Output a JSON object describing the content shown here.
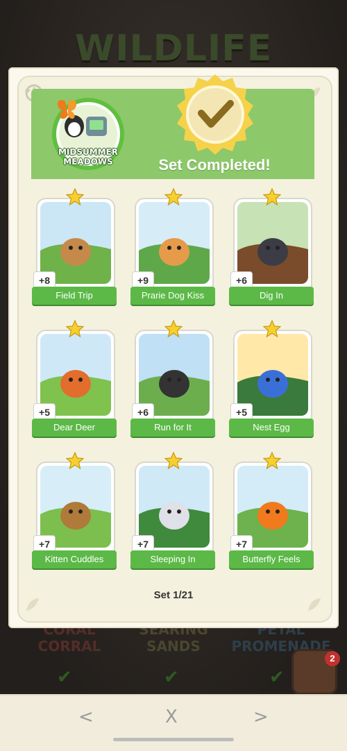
{
  "background": {
    "title": "WILDLIFE",
    "sets": [
      "CORAL CORRAL",
      "SEARING SANDS",
      "PETAL PROMENADE"
    ],
    "album_badge": "2"
  },
  "panel": {
    "set_name": "MIDSUMMER MEADOWS",
    "status": "Set Completed!",
    "counter": "Set 1/21",
    "cards": [
      {
        "label": "Field Trip",
        "points": "+8",
        "stars": 1
      },
      {
        "label": "Prarie Dog Kiss",
        "points": "+9",
        "stars": 1
      },
      {
        "label": "Dig In",
        "points": "+6",
        "stars": 1
      },
      {
        "label": "Dear Deer",
        "points": "+5",
        "stars": 1
      },
      {
        "label": "Run for It",
        "points": "+6",
        "stars": 1
      },
      {
        "label": "Nest Egg",
        "points": "+5",
        "stars": 1
      },
      {
        "label": "Kitten Cuddles",
        "points": "+7",
        "stars": 1
      },
      {
        "label": "Sleeping In",
        "points": "+7",
        "stars": 1
      },
      {
        "label": "Butterfly Feels",
        "points": "+7",
        "stars": 1
      }
    ]
  },
  "nav": {
    "prev": "<",
    "close": "X",
    "next": ">"
  },
  "colors": {
    "header_green": "#8dc86a",
    "label_green": "#5cb947",
    "seal_gold": "#f5d24a"
  }
}
